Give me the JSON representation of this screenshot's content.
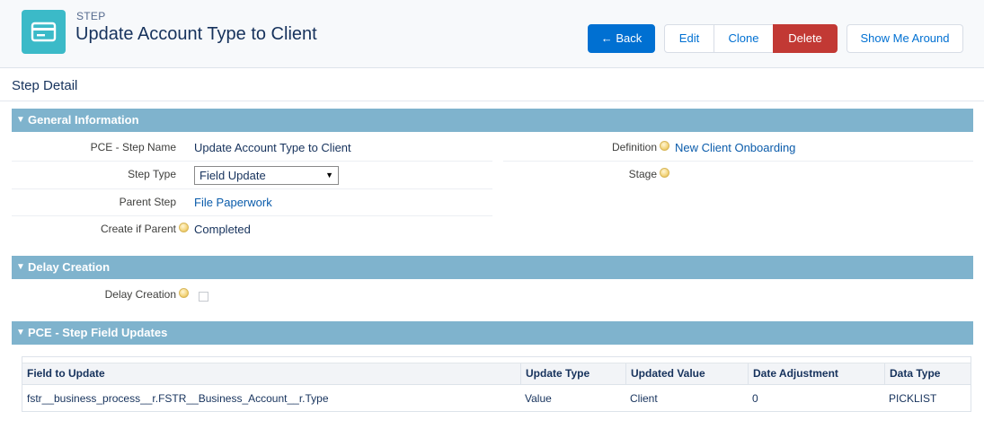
{
  "header": {
    "object_type": "STEP",
    "title": "Update Account Type to Client",
    "icon": "card-icon",
    "buttons": {
      "back": "← Back",
      "edit": "Edit",
      "clone": "Clone",
      "delete": "Delete",
      "tour": "Show Me Around"
    }
  },
  "detail": {
    "title": "Step Detail"
  },
  "general": {
    "heading": "General Information",
    "step_name_label": "PCE - Step Name",
    "step_name_value": "Update Account Type to Client",
    "definition_label": "Definition",
    "definition_value": "New Client Onboarding",
    "step_type_label": "Step Type",
    "step_type_value": "Field Update",
    "stage_label": "Stage",
    "parent_step_label": "Parent Step",
    "parent_step_value": "File Paperwork",
    "create_if_parent_label": "Create if Parent",
    "create_if_parent_value": "Completed"
  },
  "delay": {
    "heading": "Delay Creation",
    "delay_creation_label": "Delay Creation",
    "delay_creation_checked": false
  },
  "field_updates": {
    "heading": "PCE - Step Field Updates",
    "columns": [
      "Field to Update",
      "Update Type",
      "Updated Value",
      "Date Adjustment",
      "Data Type"
    ],
    "rows": [
      [
        "fstr__business_process__r.FSTR__Business_Account__r.Type",
        "Value",
        "Client",
        "0",
        "PICKLIST"
      ]
    ]
  },
  "colors": {
    "accent": "#0070d2",
    "danger": "#c23934",
    "section": "#7fb3cd",
    "icon_bg": "#3bbac8"
  }
}
